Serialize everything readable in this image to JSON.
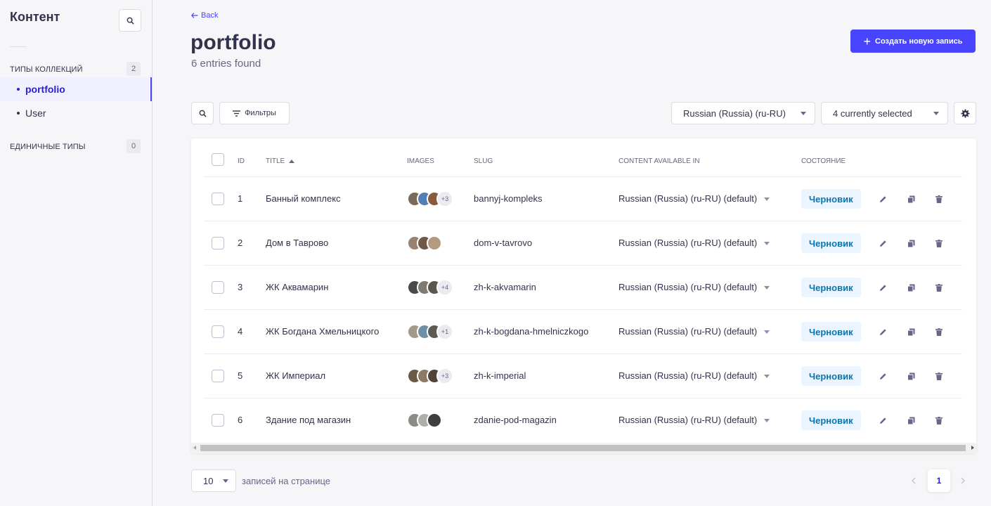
{
  "sidebar": {
    "title": "Контент",
    "collection_types": {
      "label": "Типы коллекций",
      "count": "2",
      "items": [
        {
          "label": "portfolio",
          "active": true
        },
        {
          "label": "User",
          "active": false
        }
      ]
    },
    "single_types": {
      "label": "Единичные типы",
      "count": "0"
    }
  },
  "header": {
    "back_label": "Back",
    "title": "portfolio",
    "subtitle": "6 entries found",
    "create_label": "Создать новую запись"
  },
  "toolbar": {
    "filters_label": "Фильтры",
    "locale_value": "Russian (Russia) (ru-RU)",
    "columns_value": "4 currently selected"
  },
  "table": {
    "headers": {
      "id": "ID",
      "title": "Title",
      "images": "Images",
      "slug": "Slug",
      "content_available": "Content available in",
      "state": "Состояние"
    },
    "rows": [
      {
        "id": "1",
        "title": "Банный комплекс",
        "more": "+3",
        "slug": "bannyj-kompleks",
        "locale": "Russian (Russia) (ru-RU) (default)",
        "status": "Черновик",
        "thumbs": [
          "#7a6a5a",
          "#4f7fb5",
          "#8b5a3c"
        ]
      },
      {
        "id": "2",
        "title": "Дом в Таврово",
        "more": "",
        "slug": "dom-v-tavrovo",
        "locale": "Russian (Russia) (ru-RU) (default)",
        "status": "Черновик",
        "thumbs": [
          "#9a8270",
          "#6e5a4a",
          "#b49a80"
        ]
      },
      {
        "id": "3",
        "title": "ЖК Аквамарин",
        "more": "+4",
        "slug": "zh-k-akvamarin",
        "locale": "Russian (Russia) (ru-RU) (default)",
        "status": "Черновик",
        "thumbs": [
          "#4a4a4a",
          "#7f7a72",
          "#5a5650"
        ]
      },
      {
        "id": "4",
        "title": "ЖК Богдана Хмельницкого",
        "more": "+1",
        "slug": "zh-k-bogdana-hmelniczkogo",
        "locale": "Russian (Russia) (ru-RU) (default)",
        "status": "Черновик",
        "thumbs": [
          "#a39a8c",
          "#6f8fa6",
          "#5d5a55"
        ]
      },
      {
        "id": "5",
        "title": "ЖК Империал",
        "more": "+3",
        "slug": "zh-k-imperial",
        "locale": "Russian (Russia) (ru-RU) (default)",
        "status": "Черновик",
        "thumbs": [
          "#6a5a48",
          "#8c7a64",
          "#4e4438"
        ]
      },
      {
        "id": "6",
        "title": "Здание под магазин",
        "more": "",
        "slug": "zdanie-pod-magazin",
        "locale": "Russian (Russia) (ru-RU) (default)",
        "status": "Черновик",
        "thumbs": [
          "#8a8a86",
          "#b0aea8",
          "#3e3e3c"
        ]
      }
    ]
  },
  "footer": {
    "per_page_value": "10",
    "per_page_label": "записей на странице",
    "current_page": "1"
  },
  "colors": {
    "primary": "#4945ff",
    "status_bg": "#eaf5ff",
    "status_text": "#0c75af"
  }
}
